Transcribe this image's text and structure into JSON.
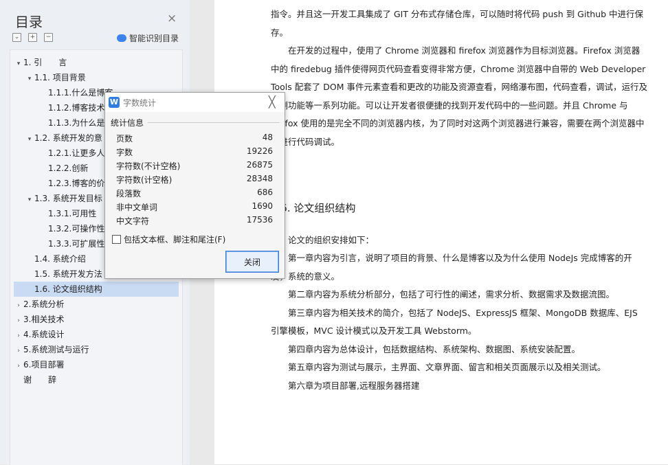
{
  "toc": {
    "title": "目录",
    "close_glyph": "×",
    "smart_label": "智能识别目录",
    "items": [
      {
        "label": "1. 引　　言",
        "level": 0,
        "arrow": "▾"
      },
      {
        "label": "1.1. 项目背景",
        "level": 1,
        "arrow": "▾"
      },
      {
        "label": "1.1.1.什么是博客",
        "level": 2,
        "arrow": ""
      },
      {
        "label": "1.1.2.博客技术",
        "level": 2,
        "arrow": ""
      },
      {
        "label": "1.1.3.为什么是",
        "level": 2,
        "arrow": ""
      },
      {
        "label": "1.2. 系统开发的意",
        "level": 1,
        "arrow": "▾"
      },
      {
        "label": "1.2.1.让更多人",
        "level": 2,
        "arrow": ""
      },
      {
        "label": "1.2.2.创新",
        "level": 2,
        "arrow": ""
      },
      {
        "label": "1.2.3.博客的价",
        "level": 2,
        "arrow": ""
      },
      {
        "label": "1.3. 系统开发目标",
        "level": 1,
        "arrow": "▾"
      },
      {
        "label": "1.3.1.可用性",
        "level": 2,
        "arrow": ""
      },
      {
        "label": "1.3.2.可操作性",
        "level": 2,
        "arrow": ""
      },
      {
        "label": "1.3.3.可扩展性",
        "level": 2,
        "arrow": ""
      },
      {
        "label": "1.4. 系统介绍",
        "level": 1,
        "arrow": ""
      },
      {
        "label": "1.5. 系统开发方法",
        "level": 1,
        "arrow": ""
      },
      {
        "label": "1.6. 论文组织结构",
        "level": 1,
        "arrow": "",
        "active": true
      },
      {
        "label": "2.系统分析",
        "level": 0,
        "arrow": "›"
      },
      {
        "label": "3.相关技术",
        "level": 0,
        "arrow": "›"
      },
      {
        "label": "4.系统设计",
        "level": 0,
        "arrow": "›"
      },
      {
        "label": "5.系统测试与运行",
        "level": 0,
        "arrow": "›"
      },
      {
        "label": "6.项目部署",
        "level": 0,
        "arrow": "›"
      },
      {
        "label": "谢　　辞",
        "level": 0,
        "arrow": ""
      }
    ]
  },
  "document": {
    "para1": "指令。并且这一开发工具集成了 GIT 分布式存储仓库，可以随时将代码 push 到 Github 中进行保存。",
    "para2": "在开发的过程中，使用了 Chrome 浏览器和 firefox 浏览器作为目标浏览器。Firefox 浏览器中的 firedebug 插件使得网页代码查看变得非常方便，Chrome 浏览器中自带的 Web Developer Tools 配套了 DOM 事件元素查看和更改的功能及资源查看，网络瀑布图，代码查看，调试，运行及检测功能等一系列功能。可以让开发者很便捷的找到开发代码中的一些问题。并且 Chrome 与 firefox 使用的是完全不同的浏览器内核，为了同时对这两个浏览器进行兼容，需要在两个浏览器中都进行代码调试。",
    "heading": "1.6.  论文组织结构",
    "intro": "论文的组织安排如下：",
    "ch1": "第一章内容为引言，说明了项目的背景、什么是博客以及为什么使用 NodeJs 完成博客的开发，系统的意义。",
    "ch2": "第二章内容为系统分析部分，包括了可行性的阐述，需求分析、数据需求及数据流图。",
    "ch3": "第三章内容为相关技术的简介，包括了 NodeJS、ExpressJS 框架、MongoDB 数据库、EJS 引擎模板，MVC 设计模式以及开发工具 Webstorm。",
    "ch4": "第四章内容为总体设计，包括数据结构、系统架构、数据图、系统安装配置。",
    "ch5": "第五章内容为测试与展示，主界面、文章界面、留言和相关页面展示以及相关测试。",
    "ch6": "第六章为项目部署,远程服务器搭建"
  },
  "dialog": {
    "title": "字数统计",
    "icon": "W",
    "close_glyph": "╳",
    "section_label": "统计信息",
    "stats": [
      {
        "label": "页数",
        "value": "48"
      },
      {
        "label": "字数",
        "value": "19226"
      },
      {
        "label": "字符数(不计空格)",
        "value": "26875"
      },
      {
        "label": "字符数(计空格)",
        "value": "28348"
      },
      {
        "label": "段落数",
        "value": "686"
      },
      {
        "label": "非中文单词",
        "value": "1690"
      },
      {
        "label": "中文字符",
        "value": "17536"
      }
    ],
    "checkbox_label": "包括文本框、脚注和尾注(F)",
    "close_button": "关闭"
  }
}
